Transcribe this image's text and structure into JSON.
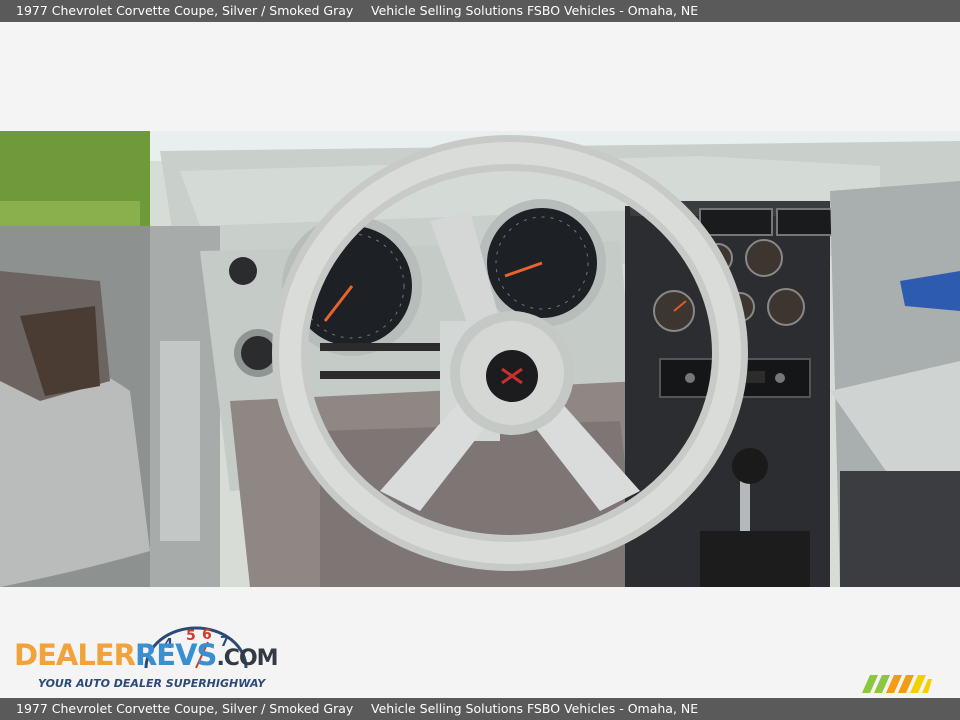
{
  "header": {
    "vehicle": "1977 Chevrolet Corvette Coupe,  Silver / Smoked Gray",
    "dealer": "Vehicle Selling Solutions FSBO Vehicles - Omaha, NE"
  },
  "footer": {
    "vehicle": "1977 Chevrolet Corvette Coupe,  Silver / Smoked Gray",
    "dealer": "Vehicle Selling Solutions FSBO Vehicles - Omaha, NE"
  },
  "logo": {
    "part1": "DEALER",
    "part2": "REVS",
    "part3": ".COM",
    "tagline": "YOUR AUTO DEALER SUPERHIGHWAY",
    "gauge_digits": "4 5 6 7"
  },
  "photo": {
    "subject": "steering-wheel-interior"
  },
  "colors": {
    "bar_bg": "#5a5a5a",
    "logo_orange": "#f2a23a",
    "logo_blue": "#3a8fd0",
    "badge_green": "#8dc63f",
    "badge_yellow": "#f5d000",
    "badge_orange": "#f39c12"
  },
  "icons": {
    "badge": "stripes-badge-icon"
  }
}
